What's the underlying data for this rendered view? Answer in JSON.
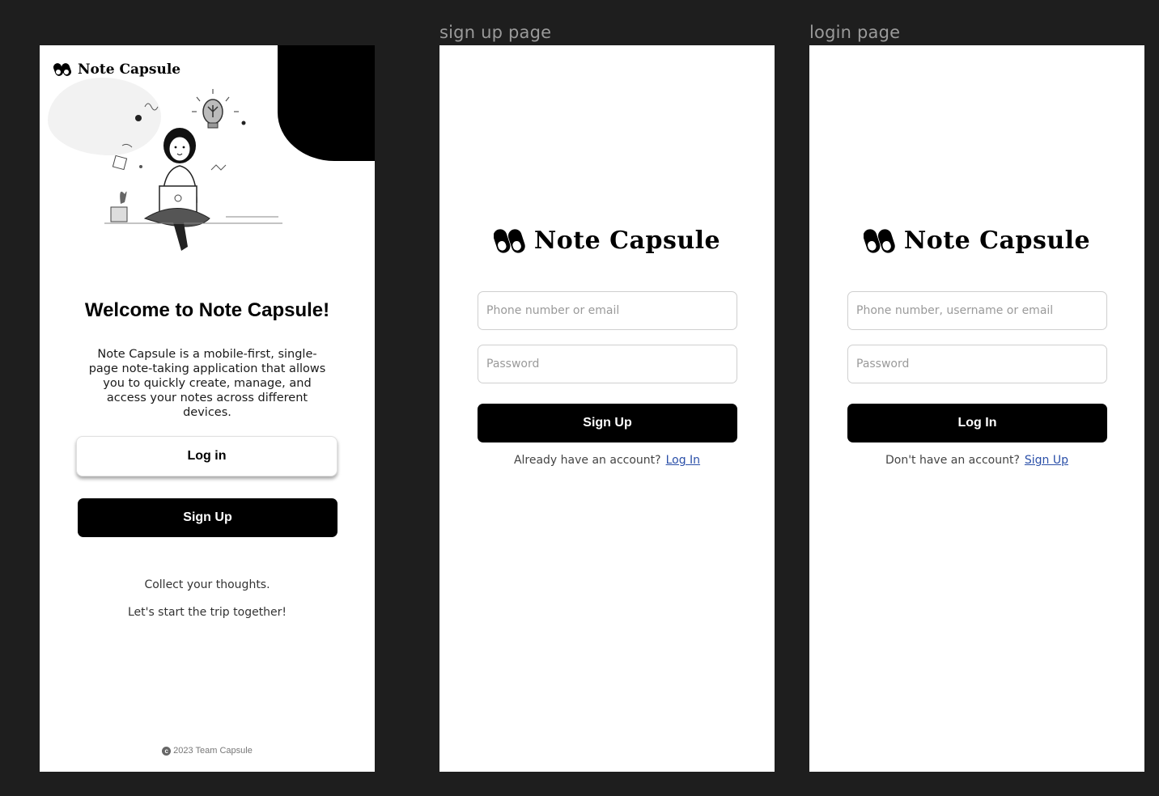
{
  "frames": {
    "signup_label": "sign up page",
    "login_label": "login page"
  },
  "brand": {
    "name": "Note Capsule"
  },
  "welcome": {
    "title": "Welcome to Note Capsule!",
    "description": "Note Capsule is a mobile-first, single-page note-taking application that allows you to quickly create, manage, and access your notes across different devices.",
    "login_label": "Log in",
    "signup_label": "Sign Up",
    "tagline_1": "Collect your thoughts.",
    "tagline_2": "Let's start the trip together!",
    "footer": "2023 Team Capsule"
  },
  "signup": {
    "identifier_placeholder": "Phone number or email",
    "password_placeholder": "Password",
    "submit_label": "Sign Up",
    "switch_text": "Already have an account?",
    "switch_link": "Log In"
  },
  "login": {
    "identifier_placeholder": "Phone number, username or email",
    "password_placeholder": "Password",
    "submit_label": "Log In",
    "switch_text": "Don't have an account?",
    "switch_link": "Sign Up"
  },
  "colors": {
    "canvas": "#1e1e1e",
    "frame": "#ffffff",
    "primary_button": "#000000",
    "link": "#2a4fa8"
  },
  "icons": [
    "capsule-logo-icon",
    "copyright-icon",
    "woman-laptop-illustration"
  ]
}
